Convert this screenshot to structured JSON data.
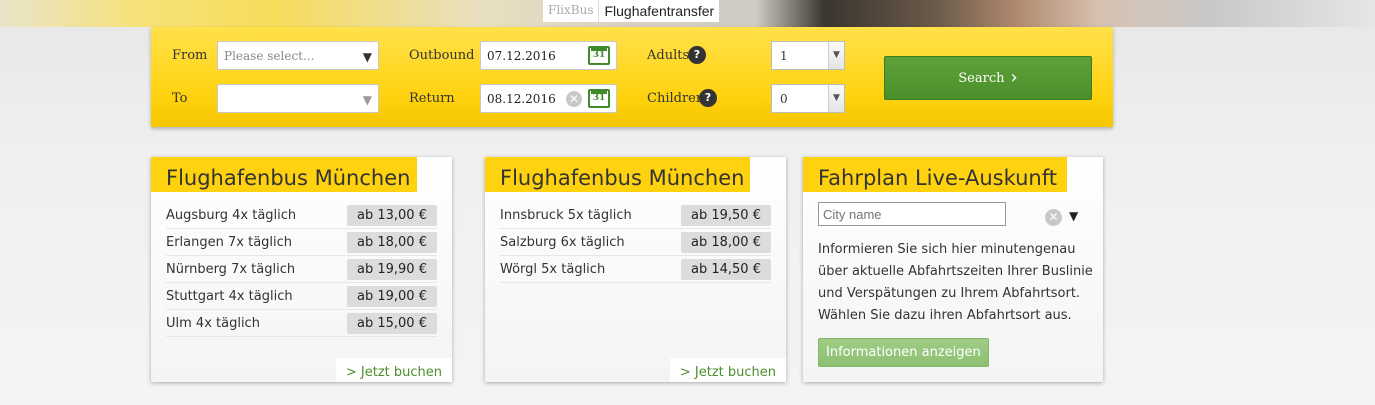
{
  "hero": {
    "tabs": [
      {
        "label": "FlixBus"
      },
      {
        "label": "Flughafentransfer"
      }
    ]
  },
  "search": {
    "from_label": "From",
    "from_placeholder": "Please select...",
    "to_label": "To",
    "to_value": "",
    "outbound_label": "Outbound",
    "outbound_value": "07.12.2016",
    "return_label": "Return",
    "return_value": "08.12.2016",
    "calendar_glyph": "31",
    "adults_label": "Adults",
    "adults_value": "1",
    "children_label": "Children",
    "children_value": "0",
    "help_glyph": "?",
    "search_button": "Search",
    "accent_color": "#ffd20f",
    "button_color": "#4a8f2a"
  },
  "boxes": [
    {
      "title": "Flughafenbus München",
      "routes": [
        {
          "name": "Augsburg 4x täglich",
          "price": "ab 13,00 €"
        },
        {
          "name": "Erlangen 7x täglich",
          "price": "ab 18,00 €"
        },
        {
          "name": "Nürnberg 7x täglich",
          "price": "ab 19,90 €"
        },
        {
          "name": "Stuttgart 4x täglich",
          "price": "ab 19,00 €"
        },
        {
          "name": "Ulm 4x täglich",
          "price": "ab 15,00 €"
        }
      ],
      "book_link": "> Jetzt buchen"
    },
    {
      "title": "Flughafenbus München",
      "routes": [
        {
          "name": "Innsbruck 5x täglich",
          "price": "ab 19,50 €"
        },
        {
          "name": "Salzburg 6x täglich",
          "price": "ab 18,00 €"
        },
        {
          "name": "Wörgl 5x täglich",
          "price": "ab 14,50 €"
        }
      ],
      "book_link": "> Jetzt buchen"
    }
  ],
  "live": {
    "title": "Fahrplan Live-Auskunft",
    "city_placeholder": "City name",
    "info_text": "Informieren Sie sich hier minutengenau über aktuelle Abfahrtszeiten Ihrer Buslinie und Verspätungen zu Ihrem Abfahrtsort. Wählen Sie dazu ihren Abfahrtsort aus.",
    "info_button": "Informationen anzeigen"
  }
}
